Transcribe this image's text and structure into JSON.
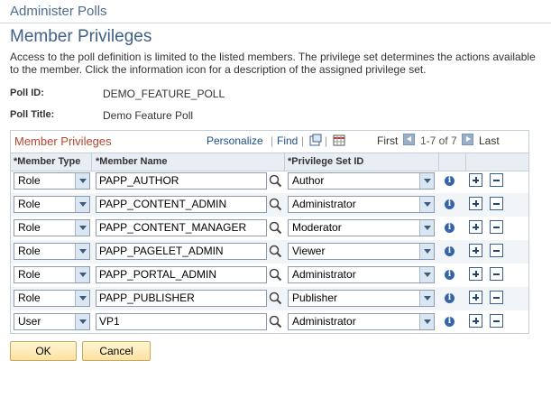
{
  "header": {
    "breadcrumb": "Administer Polls",
    "title": "Member Privileges"
  },
  "description": "Access to the poll definition is limited to the listed members.  The privilege set determines the actions available to the member.  Click the information icon for a description of the assigned privilege set.",
  "poll": {
    "id_label": "Poll ID:",
    "id_value": "DEMO_FEATURE_POLL",
    "title_label": "Poll Title:",
    "title_value": "Demo Feature Poll"
  },
  "grid": {
    "title": "Member Privileges",
    "personalize": "Personalize",
    "separator": "|",
    "find": "Find",
    "first": "First",
    "range": "1-7 of 7",
    "last": "Last",
    "columns": {
      "member_type": "*Member Type",
      "member_name": "*Member Name",
      "privilege_set": "*Privilege Set ID"
    },
    "rows": [
      {
        "type": "Role",
        "name": "PAPP_AUTHOR",
        "privilege": "Author"
      },
      {
        "type": "Role",
        "name": "PAPP_CONTENT_ADMIN",
        "privilege": "Administrator"
      },
      {
        "type": "Role",
        "name": "PAPP_CONTENT_MANAGER",
        "privilege": "Moderator"
      },
      {
        "type": "Role",
        "name": "PAPP_PAGELET_ADMIN",
        "privilege": "Viewer"
      },
      {
        "type": "Role",
        "name": "PAPP_PORTAL_ADMIN",
        "privilege": "Administrator"
      },
      {
        "type": "Role",
        "name": "PAPP_PUBLISHER",
        "privilege": "Publisher"
      },
      {
        "type": "User",
        "name": "VP1",
        "privilege": "Administrator"
      }
    ],
    "info_glyph": "i"
  },
  "buttons": {
    "ok": "OK",
    "cancel": "Cancel"
  },
  "icons": {
    "lookup": "magnifier-icon",
    "info": "info-icon",
    "add": "plus-icon",
    "delete": "minus-icon",
    "zoom": "view-all-icon",
    "download": "download-grid-icon",
    "prev": "arrow-left-icon",
    "next": "arrow-right-icon"
  }
}
